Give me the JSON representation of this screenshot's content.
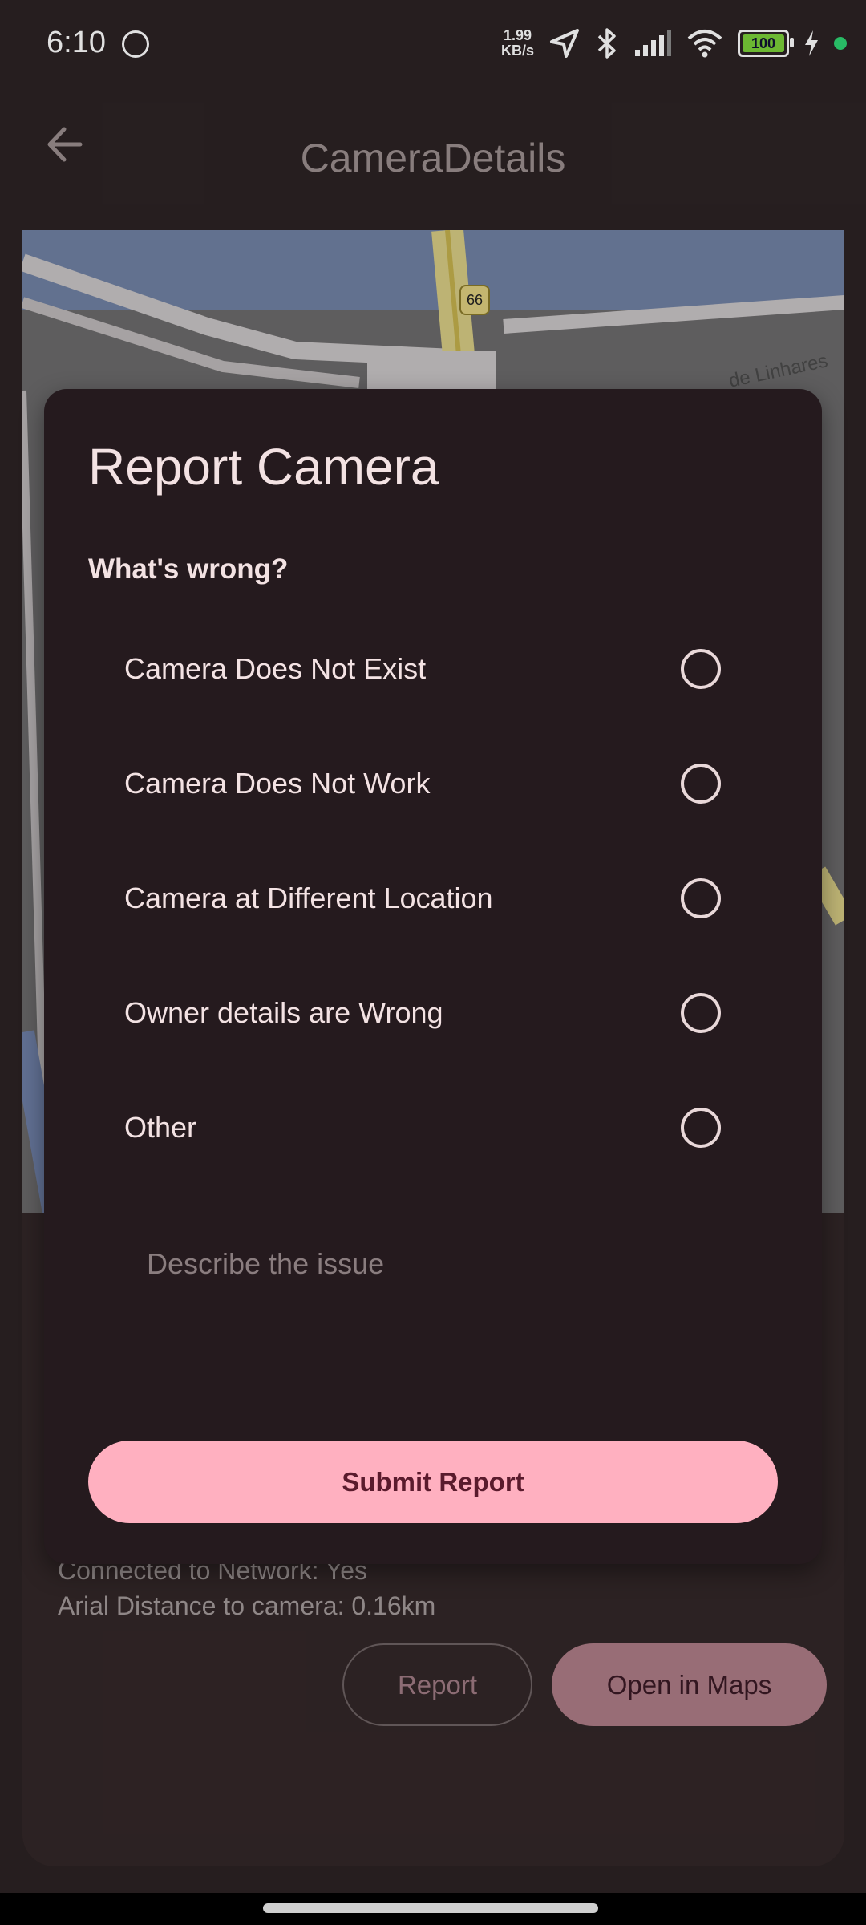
{
  "status_bar": {
    "time": "6:10",
    "speed_value": "1.99",
    "speed_unit": "KB/s",
    "battery": "100",
    "icons": [
      "location-icon",
      "bluetooth-icon",
      "signal-icon",
      "wifi-icon",
      "charging-icon"
    ]
  },
  "app_bar": {
    "title": "CameraDetails",
    "back_icon": "arrow-left-icon"
  },
  "map": {
    "route_label": "66",
    "street_label": "de Linhares"
  },
  "camera_info": {
    "network_line": "Connected to Network: Yes",
    "distance_line": "Arial Distance to camera: 0.16km",
    "report_button": "Report",
    "maps_button": "Open in Maps"
  },
  "dialog": {
    "title": "Report Camera",
    "subtitle": "What's wrong?",
    "options": [
      {
        "label": "Camera Does Not Exist",
        "selected": false
      },
      {
        "label": "Camera Does Not Work",
        "selected": false
      },
      {
        "label": "Camera at Different Location",
        "selected": false
      },
      {
        "label": "Owner details are Wrong",
        "selected": false
      },
      {
        "label": "Other",
        "selected": false
      }
    ],
    "describe_placeholder": "Describe the issue",
    "submit_label": "Submit Report"
  },
  "colors": {
    "accent": "#ffb0c0",
    "dialog_bg": "#251a1e",
    "page_bg": "#2c2324"
  }
}
